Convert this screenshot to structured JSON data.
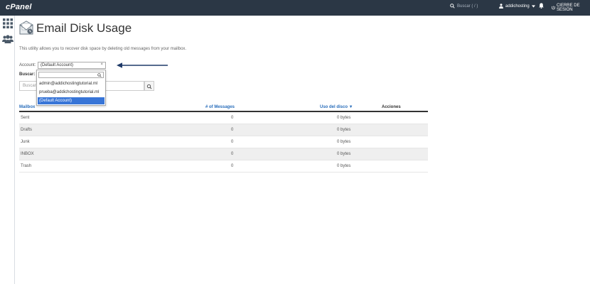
{
  "topbar": {
    "logo": "cPanel",
    "search_placeholder": "Buscar ( / )",
    "user": "addichosting",
    "logout": "CIERRE DE SESIÓN"
  },
  "page": {
    "title": "Email Disk Usage",
    "description": "This utility allows you to recover disk space by deleting old messages from your mailbox."
  },
  "account": {
    "label": "Account:",
    "selected": "(Default Account)",
    "clear": "×"
  },
  "search": {
    "label": "Buscar:",
    "placeholder": "Buscar"
  },
  "dropdown": {
    "options": [
      "admin@addichostingtutorial.ml",
      "prueba@addichostingtutorial.ml",
      "(Default Account)"
    ],
    "selected_index": 2
  },
  "table": {
    "headers": {
      "mailbox": "Mailbox",
      "messages": "# of Messages",
      "disk": "Uso del disco ▼",
      "actions": "Acciones"
    },
    "rows": [
      {
        "mailbox": "Sent",
        "messages": "0",
        "disk": "0 bytes"
      },
      {
        "mailbox": "Drafts",
        "messages": "0",
        "disk": "0 bytes"
      },
      {
        "mailbox": "Junk",
        "messages": "0",
        "disk": "0 bytes"
      },
      {
        "mailbox": "INBOX",
        "messages": "0",
        "disk": "0 bytes"
      },
      {
        "mailbox": "Trash",
        "messages": "0",
        "disk": "0 bytes"
      }
    ]
  },
  "colors": {
    "topbar": "#2b3745",
    "link": "#2a6ebb",
    "selected": "#3875d7",
    "arrow": "#1f3a68"
  },
  "icons": {
    "apps": "grid-icon",
    "users": "users-icon",
    "search": "search-icon",
    "user": "user-icon",
    "bell": "bell-icon",
    "logout": "logout-icon",
    "email": "envelope-icon"
  }
}
